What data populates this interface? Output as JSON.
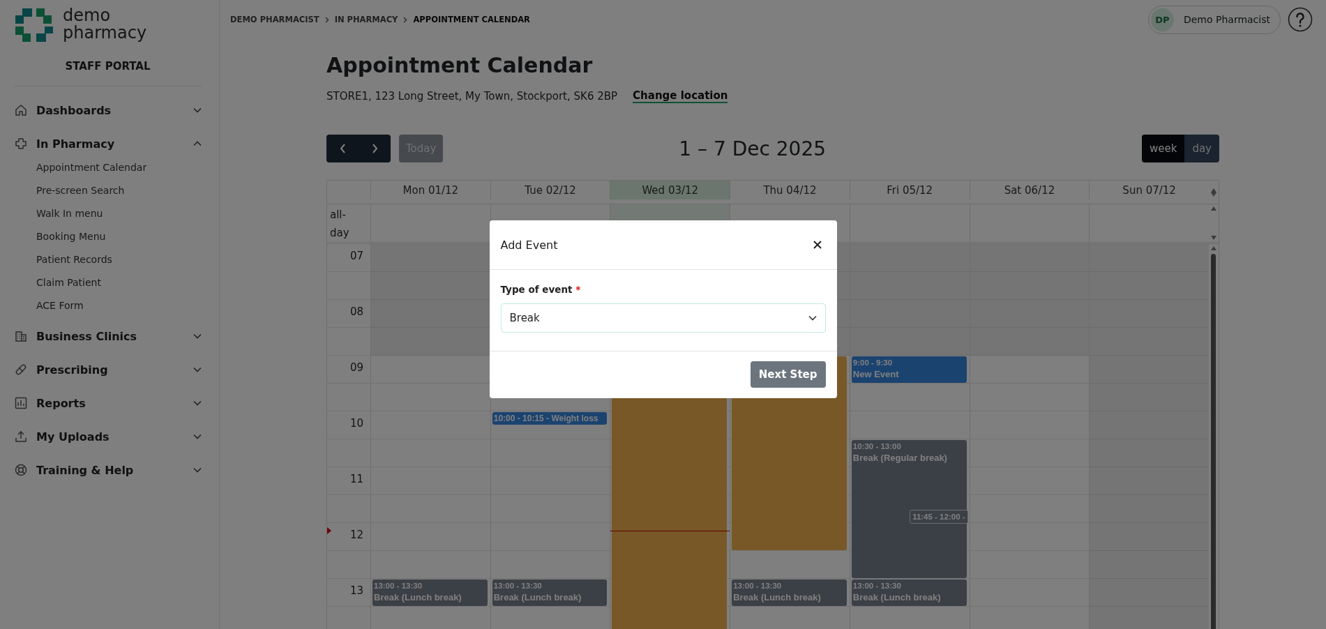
{
  "sidebar": {
    "logo_text": "demo pharmacy",
    "portal_title": "STAFF PORTAL",
    "items": [
      {
        "label": "Dashboards",
        "expanded": false
      },
      {
        "label": "In Pharmacy",
        "expanded": true,
        "children": [
          {
            "label": "Appointment Calendar"
          },
          {
            "label": "Pre-screen Search"
          },
          {
            "label": "Walk In menu"
          },
          {
            "label": "Booking Menu"
          },
          {
            "label": "Patient Records"
          },
          {
            "label": "Claim Patient"
          },
          {
            "label": "ACE Form"
          }
        ]
      },
      {
        "label": "Business Clinics",
        "expanded": false
      },
      {
        "label": "Prescribing",
        "expanded": false
      },
      {
        "label": "Reports",
        "expanded": false
      },
      {
        "label": "My Uploads",
        "expanded": false
      },
      {
        "label": "Training & Help",
        "expanded": false
      }
    ]
  },
  "breadcrumb": [
    "DEMO PHARMACIST",
    "IN PHARMACY",
    "APPOINTMENT CALENDAR"
  ],
  "user": {
    "initials": "DP",
    "name": "Demo Pharmacist"
  },
  "page": {
    "title": "Appointment Calendar",
    "address": "STORE1, 123 Long Street, My Town, Stockport, SK6 2BP",
    "change_location": "Change location"
  },
  "toolbar": {
    "today_button": {
      "label": "Today",
      "disabled": true
    },
    "range": "1 – 7 Dec 2025",
    "views": [
      {
        "label": "week",
        "selected": true
      },
      {
        "label": "day",
        "selected": false
      }
    ]
  },
  "calendar": {
    "all_day_label": "all-day",
    "hours": [
      "07",
      "08",
      "09",
      "10",
      "11",
      "12",
      "13"
    ],
    "days": [
      {
        "label": "Mon 01/12",
        "today": false,
        "closed": false,
        "events": [
          {
            "kind": "break",
            "time": "13:00 - 13:30",
            "title": "Break (Lunch break)"
          }
        ]
      },
      {
        "label": "Tue 02/12",
        "today": false,
        "closed": false,
        "events": [
          {
            "kind": "appointment",
            "title": "10:00 - 10:15 - Weight loss"
          },
          {
            "kind": "break",
            "time": "13:00 - 13:30",
            "title": "Break (Lunch break)"
          }
        ]
      },
      {
        "label": "Wed 03/12",
        "today": true,
        "closed": false,
        "events": [
          {
            "kind": "unavailable"
          }
        ]
      },
      {
        "label": "Thu 04/12",
        "today": false,
        "closed": false,
        "events": [
          {
            "kind": "unavailable"
          },
          {
            "kind": "break",
            "time": "13:00 - 13:30",
            "title": "Break (Lunch break)"
          }
        ]
      },
      {
        "label": "Fri 05/12",
        "today": false,
        "closed": false,
        "events": [
          {
            "kind": "appointment",
            "time": "9:00 - 9:30",
            "title": "New Event"
          },
          {
            "kind": "break",
            "time": "10:30 - 13:00",
            "title": "Break (Regular break)"
          },
          {
            "kind": "overlap",
            "time": "11:45 - 12:00 -"
          },
          {
            "kind": "break",
            "time": "13:00 - 13:30",
            "title": "Break (Lunch break)"
          }
        ]
      },
      {
        "label": "Sat 06/12",
        "today": false,
        "closed": false
      },
      {
        "label": "Sun 07/12",
        "today": false,
        "closed": true
      }
    ]
  },
  "modal": {
    "title": "Add Event",
    "field_label": "Type of event",
    "required_mark": "*",
    "value": "Break",
    "button": "Next Step"
  }
}
